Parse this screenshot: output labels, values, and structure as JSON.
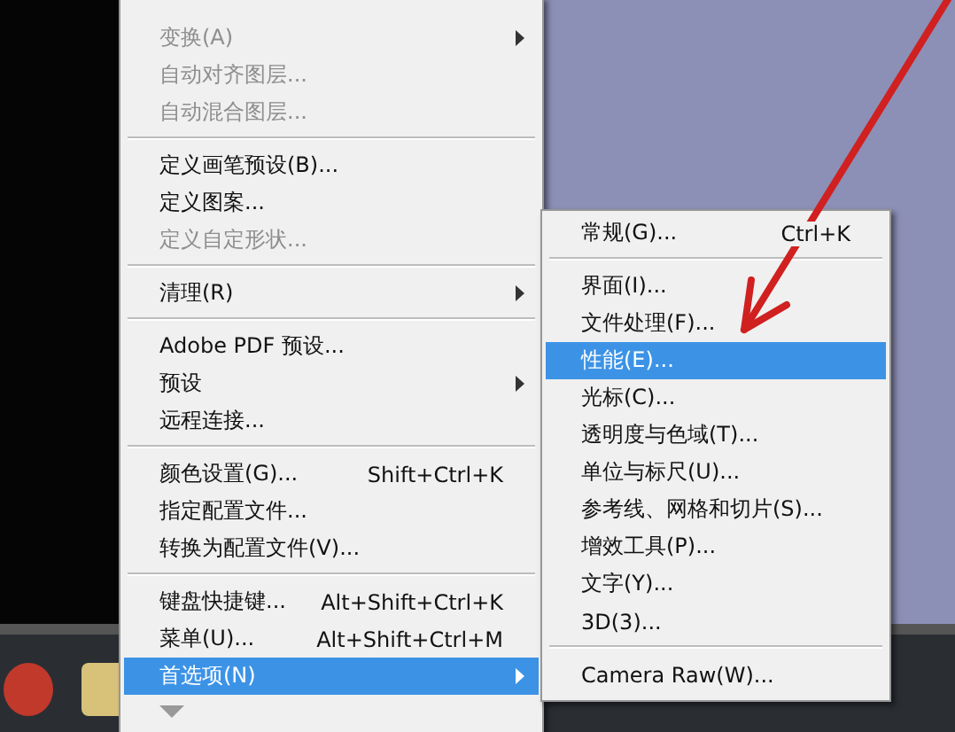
{
  "edit_menu": {
    "items": [
      {
        "kind": "item",
        "label": "变换(A)",
        "submenu": true,
        "disabled": true,
        "selected": false
      },
      {
        "kind": "item",
        "label": "自动对齐图层...",
        "submenu": false,
        "disabled": true,
        "selected": false
      },
      {
        "kind": "item",
        "label": "自动混合图层...",
        "submenu": false,
        "disabled": true,
        "selected": false
      },
      {
        "kind": "separator"
      },
      {
        "kind": "item",
        "label": "定义画笔预设(B)...",
        "submenu": false,
        "disabled": false,
        "selected": false
      },
      {
        "kind": "item",
        "label": "定义图案...",
        "submenu": false,
        "disabled": false,
        "selected": false
      },
      {
        "kind": "item",
        "label": "定义自定形状...",
        "submenu": false,
        "disabled": true,
        "selected": false
      },
      {
        "kind": "separator"
      },
      {
        "kind": "item",
        "label": "清理(R)",
        "submenu": true,
        "disabled": false,
        "selected": false
      },
      {
        "kind": "separator"
      },
      {
        "kind": "item",
        "label": "Adobe PDF 预设...",
        "submenu": false,
        "disabled": false,
        "selected": false
      },
      {
        "kind": "item",
        "label": "预设",
        "submenu": true,
        "disabled": false,
        "selected": false
      },
      {
        "kind": "item",
        "label": "远程连接...",
        "submenu": false,
        "disabled": false,
        "selected": false
      },
      {
        "kind": "separator"
      },
      {
        "kind": "item",
        "label": "颜色设置(G)...",
        "shortcut": "Shift+Ctrl+K",
        "submenu": false,
        "disabled": false,
        "selected": false
      },
      {
        "kind": "item",
        "label": "指定配置文件...",
        "submenu": false,
        "disabled": false,
        "selected": false
      },
      {
        "kind": "item",
        "label": "转换为配置文件(V)...",
        "submenu": false,
        "disabled": false,
        "selected": false
      },
      {
        "kind": "separator"
      },
      {
        "kind": "item",
        "label": "键盘快捷键...",
        "shortcut": "Alt+Shift+Ctrl+K",
        "submenu": false,
        "disabled": false,
        "selected": false
      },
      {
        "kind": "item",
        "label": "菜单(U)...",
        "shortcut": "Alt+Shift+Ctrl+M",
        "submenu": false,
        "disabled": false,
        "selected": false
      },
      {
        "kind": "item",
        "label": "首选项(N)",
        "submenu": true,
        "disabled": false,
        "selected": true
      },
      {
        "kind": "more"
      }
    ]
  },
  "preferences_submenu": {
    "items": [
      {
        "kind": "item",
        "label": "常规(G)...",
        "shortcut": "Ctrl+K",
        "selected": false
      },
      {
        "kind": "separator"
      },
      {
        "kind": "item",
        "label": "界面(I)...",
        "selected": false
      },
      {
        "kind": "item",
        "label": "文件处理(F)...",
        "selected": false
      },
      {
        "kind": "item",
        "label": "性能(E)...",
        "selected": true
      },
      {
        "kind": "item",
        "label": "光标(C)...",
        "selected": false
      },
      {
        "kind": "item",
        "label": "透明度与色域(T)...",
        "selected": false
      },
      {
        "kind": "item",
        "label": "单位与标尺(U)...",
        "selected": false
      },
      {
        "kind": "item",
        "label": "参考线、网格和切片(S)...",
        "selected": false
      },
      {
        "kind": "item",
        "label": "增效工具(P)...",
        "selected": false
      },
      {
        "kind": "item",
        "label": "文字(Y)...",
        "selected": false
      },
      {
        "kind": "item",
        "label": "3D(3)...",
        "selected": false
      },
      {
        "kind": "separator"
      },
      {
        "kind": "item",
        "label": "Camera Raw(W)...",
        "selected": false
      }
    ]
  }
}
